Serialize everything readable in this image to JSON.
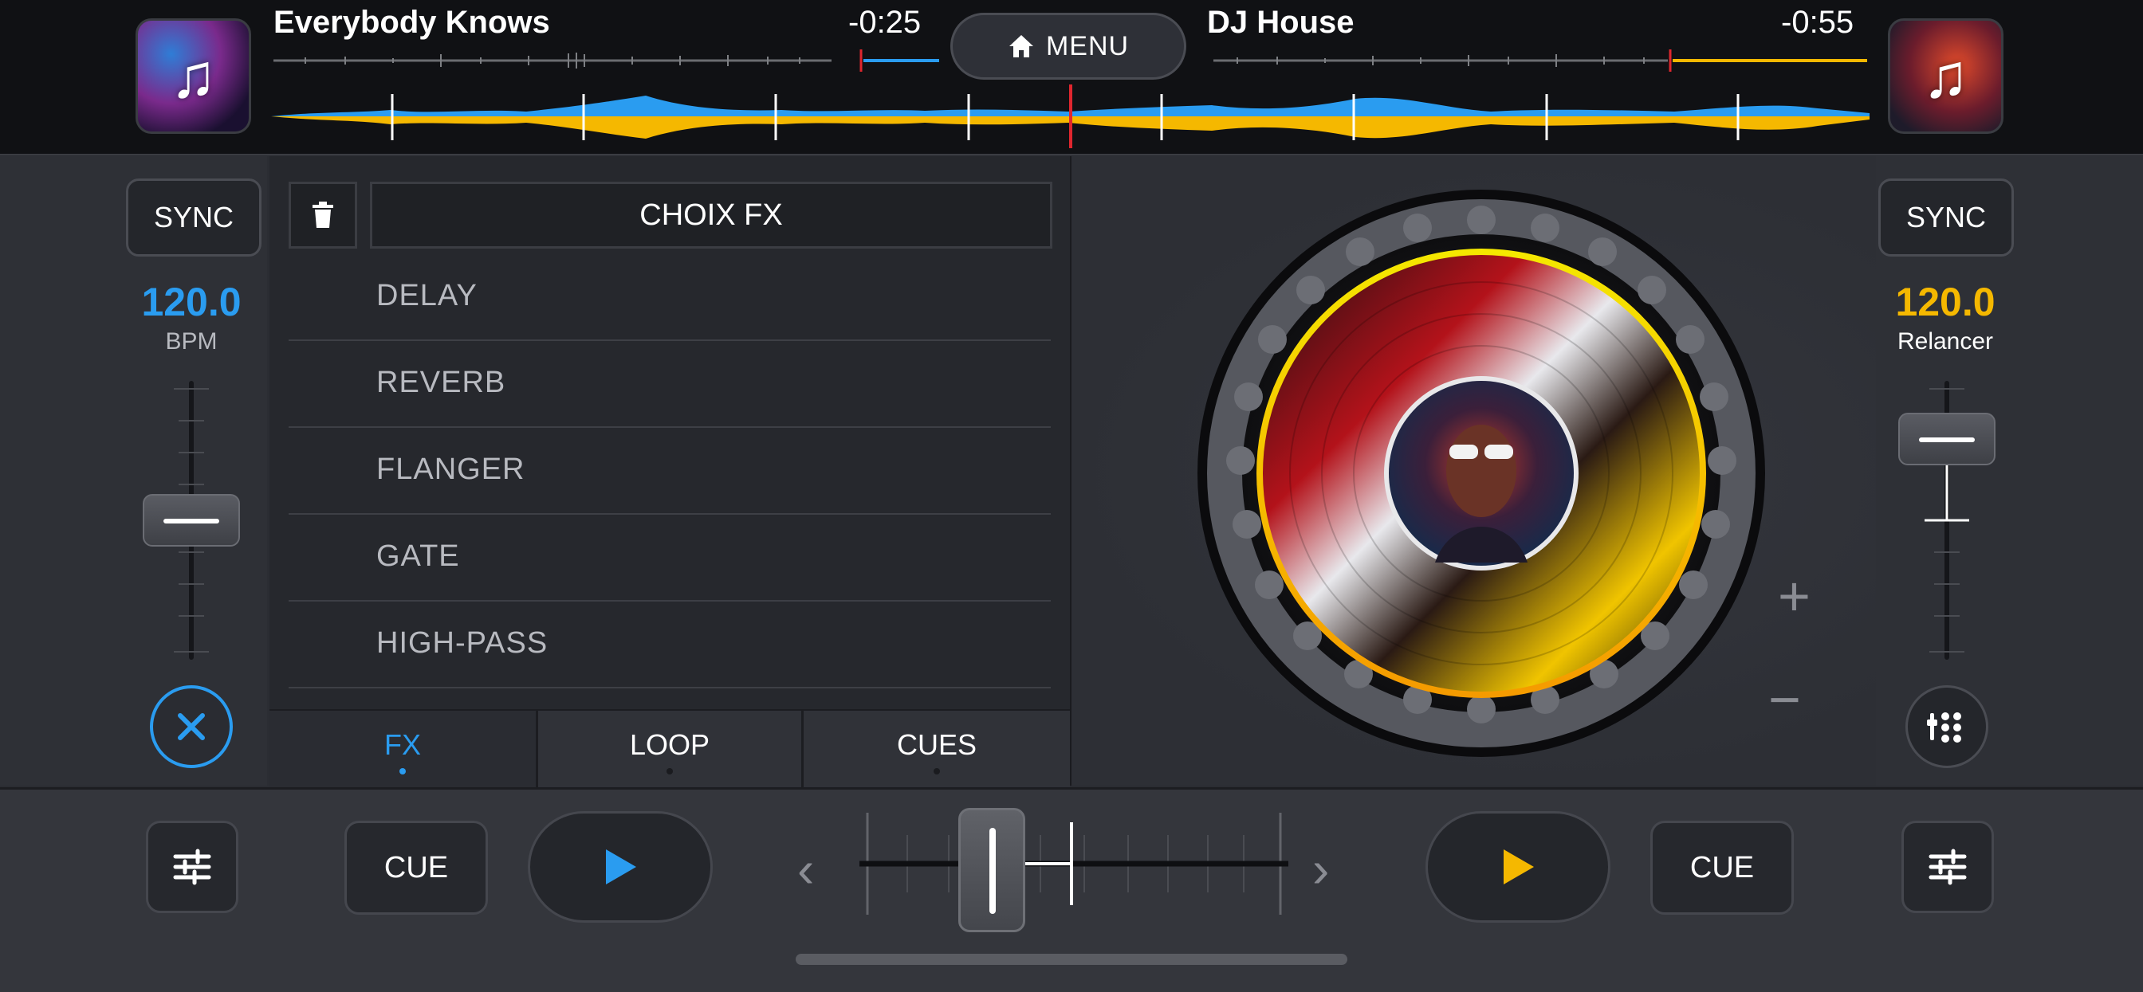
{
  "deck_left": {
    "track_title": "Everybody Knows",
    "time_remaining": "-0:25",
    "accent_color": "#2a9cf0",
    "sync_label": "SYNC",
    "bpm_value": "120.0",
    "bpm_label": "BPM",
    "cue_label": "CUE",
    "pitch_level": 0.5
  },
  "deck_right": {
    "track_title": "DJ House",
    "time_remaining": "-0:55",
    "accent_color": "#f5b800",
    "sync_label": "SYNC",
    "bpm_value": "120.0",
    "bpm_label": "Relancer",
    "cue_label": "CUE",
    "pitch_level": 0.2
  },
  "menu": {
    "label": "MENU",
    "icon": "home-icon"
  },
  "fx_panel": {
    "header_label": "CHOIX FX",
    "items": [
      "DELAY",
      "REVERB",
      "FLANGER",
      "GATE",
      "HIGH-PASS"
    ],
    "tabs": [
      {
        "label": "FX",
        "active": true
      },
      {
        "label": "LOOP",
        "active": false
      },
      {
        "label": "CUES",
        "active": false
      }
    ]
  },
  "turntable": {
    "plus_label": "+",
    "minus_label": "−",
    "ring_colors": [
      "#f5e800",
      "#f59a00"
    ]
  },
  "crossfader": {
    "prev_label": "‹",
    "next_label": "›",
    "position": 0.35
  },
  "colors": {
    "blue": "#2a9cf0",
    "yellow": "#f5b800",
    "playhead": "#e0262e"
  }
}
